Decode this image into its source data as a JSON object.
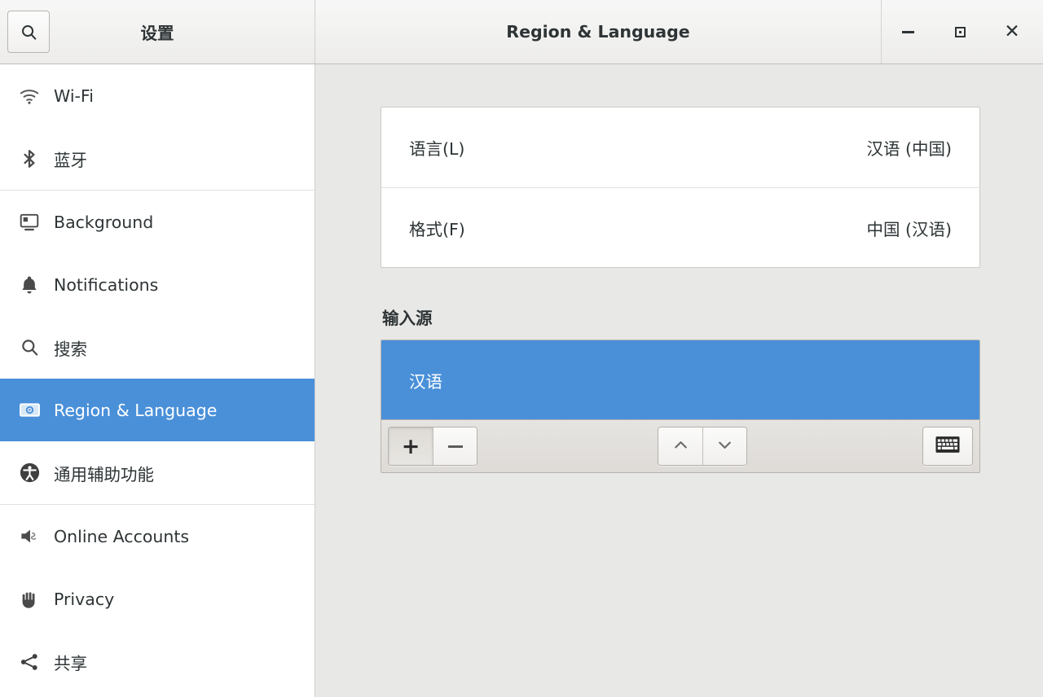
{
  "window": {
    "sidebar_title": "设置",
    "content_title": "Region & Language",
    "controls": {
      "minimize": "−",
      "maximize": "□",
      "close": "✕"
    }
  },
  "search": {
    "icon": "search-icon",
    "tooltip": "搜索"
  },
  "sidebar": {
    "groups": [
      {
        "items": [
          {
            "icon": "wifi-icon",
            "label": "Wi-Fi",
            "selected": false
          },
          {
            "icon": "bluetooth-icon",
            "label": "蓝牙",
            "selected": false
          }
        ]
      },
      {
        "items": [
          {
            "icon": "display-background-icon",
            "label": "Background",
            "selected": false
          },
          {
            "icon": "bell-notifications-icon",
            "label": "Notifications",
            "selected": false
          },
          {
            "icon": "search-icon",
            "label": "搜索",
            "selected": false
          },
          {
            "icon": "banknote-region-icon",
            "label": "Region & Language",
            "selected": true
          },
          {
            "icon": "accessibility-icon",
            "label": "通用辅助功能",
            "selected": false
          }
        ]
      },
      {
        "items": [
          {
            "icon": "online-accounts-icon",
            "label": "Online Accounts",
            "selected": false
          },
          {
            "icon": "hand-privacy-icon",
            "label": "Privacy",
            "selected": false
          },
          {
            "icon": "share-icon",
            "label": "共享",
            "selected": false
          }
        ]
      }
    ]
  },
  "main": {
    "settings_rows": [
      {
        "label": "语言(L)",
        "value": "汉语 (中国)"
      },
      {
        "label": "格式(F)",
        "value": "中国 (汉语)"
      }
    ],
    "input_sources": {
      "section_title": "输入源",
      "items": [
        {
          "label": "汉语",
          "selected": true
        }
      ],
      "toolbar": {
        "add_label": "+",
        "remove_label": "−",
        "move_up_label": "⌃",
        "move_down_label": "⌄",
        "keyboard_label": "keyboard"
      }
    }
  },
  "colors": {
    "selection_blue": "#4a90d9",
    "content_bg": "#e8e8e7",
    "sidebar_bg": "#ffffff",
    "header_bg": "#f2f2f1",
    "text": "#2e3436"
  }
}
